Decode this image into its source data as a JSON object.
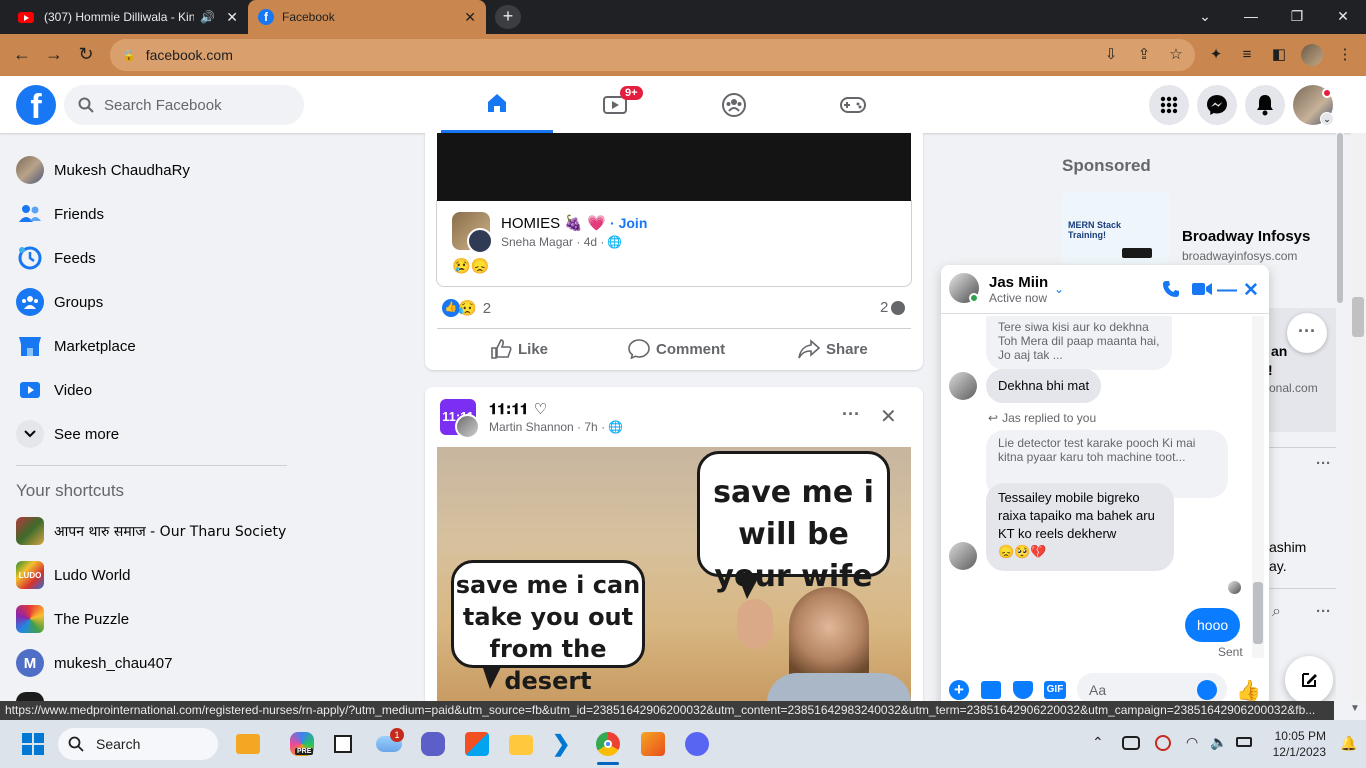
{
  "browser": {
    "tabs": [
      {
        "title": "(307) Hommie Dilliwala - Kin"
      },
      {
        "title": "Facebook"
      }
    ],
    "url": "facebook.com",
    "status_url": "https://www.medprointernational.com/registered-nurses/rn-apply/?utm_medium=paid&utm_source=fb&utm_id=23851642906200032&utm_content=23851642983240032&utm_term=23851642906220032&utm_campaign=23851642906200032&fb..."
  },
  "header": {
    "search_placeholder": "Search Facebook",
    "watch_badge": "9+"
  },
  "sidebar": {
    "items": [
      {
        "label": "Mukesh ChaudhaRy"
      },
      {
        "label": "Friends"
      },
      {
        "label": "Feeds"
      },
      {
        "label": "Groups"
      },
      {
        "label": "Marketplace"
      },
      {
        "label": "Video"
      },
      {
        "label": "See more"
      }
    ],
    "shortcuts_title": "Your shortcuts",
    "shortcuts": [
      {
        "label": "आपन थारु समाज - Our Tharu Society"
      },
      {
        "label": "Ludo World"
      },
      {
        "label": "The Puzzle"
      },
      {
        "label": "mukesh_chau407"
      }
    ]
  },
  "post1": {
    "group_name": "HOMIES 🍇 💗",
    "join_label": "· Join",
    "author_line": "Sneha Magar · 4d ·",
    "emoji": "😢😞",
    "reaction_count": "2",
    "comment_count": "2",
    "like_label": "Like",
    "comment_label": "Comment",
    "share_label": "Share"
  },
  "post2": {
    "page_name": "𝟏𝟏:𝟏𝟏 ♡",
    "author_line": "Martin Shannon · 7h ·",
    "meme_text_right": "save me i will be your wife",
    "meme_text_left": "save me i can take you out from the desert"
  },
  "right": {
    "sponsored_title": "Sponsored",
    "ad_name": "Broadway Infosys",
    "ad_domain": "broadwayinfosys.com",
    "ad_img_title": "MERN Stack Training!",
    "partial1": "an",
    "partial2": "!",
    "partial3": "onal.com",
    "partial4": "ashim",
    "partial5": "ay."
  },
  "chat": {
    "name": "Jas Miin",
    "status": "Active now",
    "messages": {
      "m1": "Tere siwa kisi aur ko dekhna Toh Mera dil paap maanta hai, Jo aaj tak ...",
      "m2": "Dekhna bhi mat",
      "reply_note": "Jas replied to you",
      "m3": "Lie detector test karake pooch Ki mai kitna pyaar karu toh machine toot...",
      "m4": "Tessailey mobile bigreko raixa tapaiko ma bahek aru KT ko reels dekherw",
      "m4_emoji": "😞🥺💔",
      "m5": "hooo",
      "sent": "Sent"
    },
    "input_placeholder": "Aa",
    "gif_label": "GIF"
  },
  "taskbar": {
    "search_label": "Search",
    "time": "10:05 PM",
    "date": "12/1/2023",
    "weather_badge": "1",
    "copilot_label": "PRE"
  }
}
